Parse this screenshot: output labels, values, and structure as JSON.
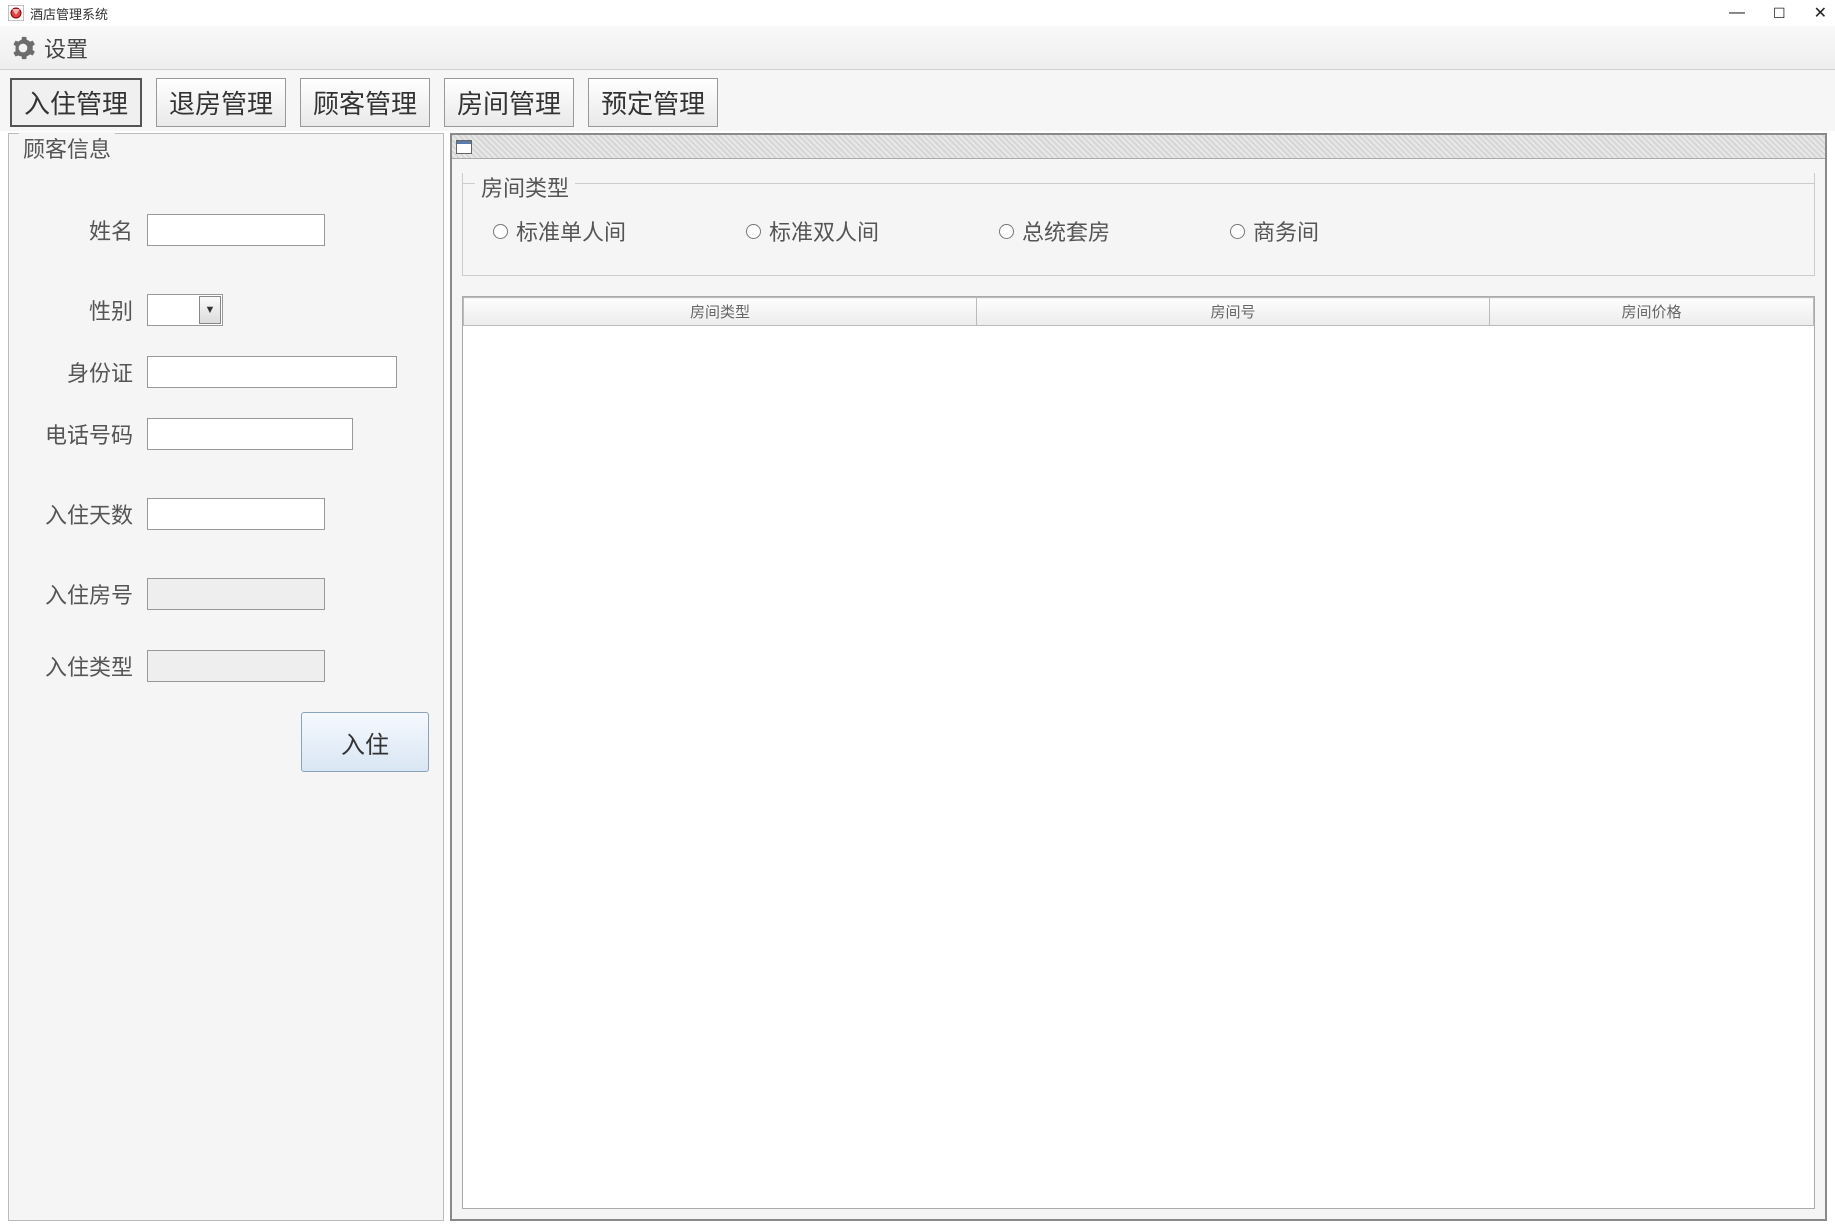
{
  "window": {
    "title": "酒店管理系统"
  },
  "menu": {
    "settings": "设置"
  },
  "tabs": {
    "checkin": "入住管理",
    "checkout": "退房管理",
    "customer": "顾客管理",
    "room": "房间管理",
    "reservation": "预定管理"
  },
  "customerInfo": {
    "legend": "顾客信息",
    "labels": {
      "name": "姓名",
      "gender": "性别",
      "idcard": "身份证",
      "phone": "电话号码",
      "days": "入住天数",
      "roomNo": "入住房号",
      "roomType": "入住类型"
    },
    "values": {
      "name": "",
      "gender": "",
      "idcard": "",
      "phone": "",
      "days": "",
      "roomNo": "",
      "roomType": ""
    },
    "submit": "入住"
  },
  "roomTypeGroup": {
    "legend": "房间类型",
    "options": {
      "standardSingle": "标准单人间",
      "standardDouble": "标准双人间",
      "presidential": "总统套房",
      "business": "商务间"
    }
  },
  "table": {
    "headers": {
      "roomType": "房间类型",
      "roomNo": "房间号",
      "roomPrice": "房间价格"
    }
  }
}
